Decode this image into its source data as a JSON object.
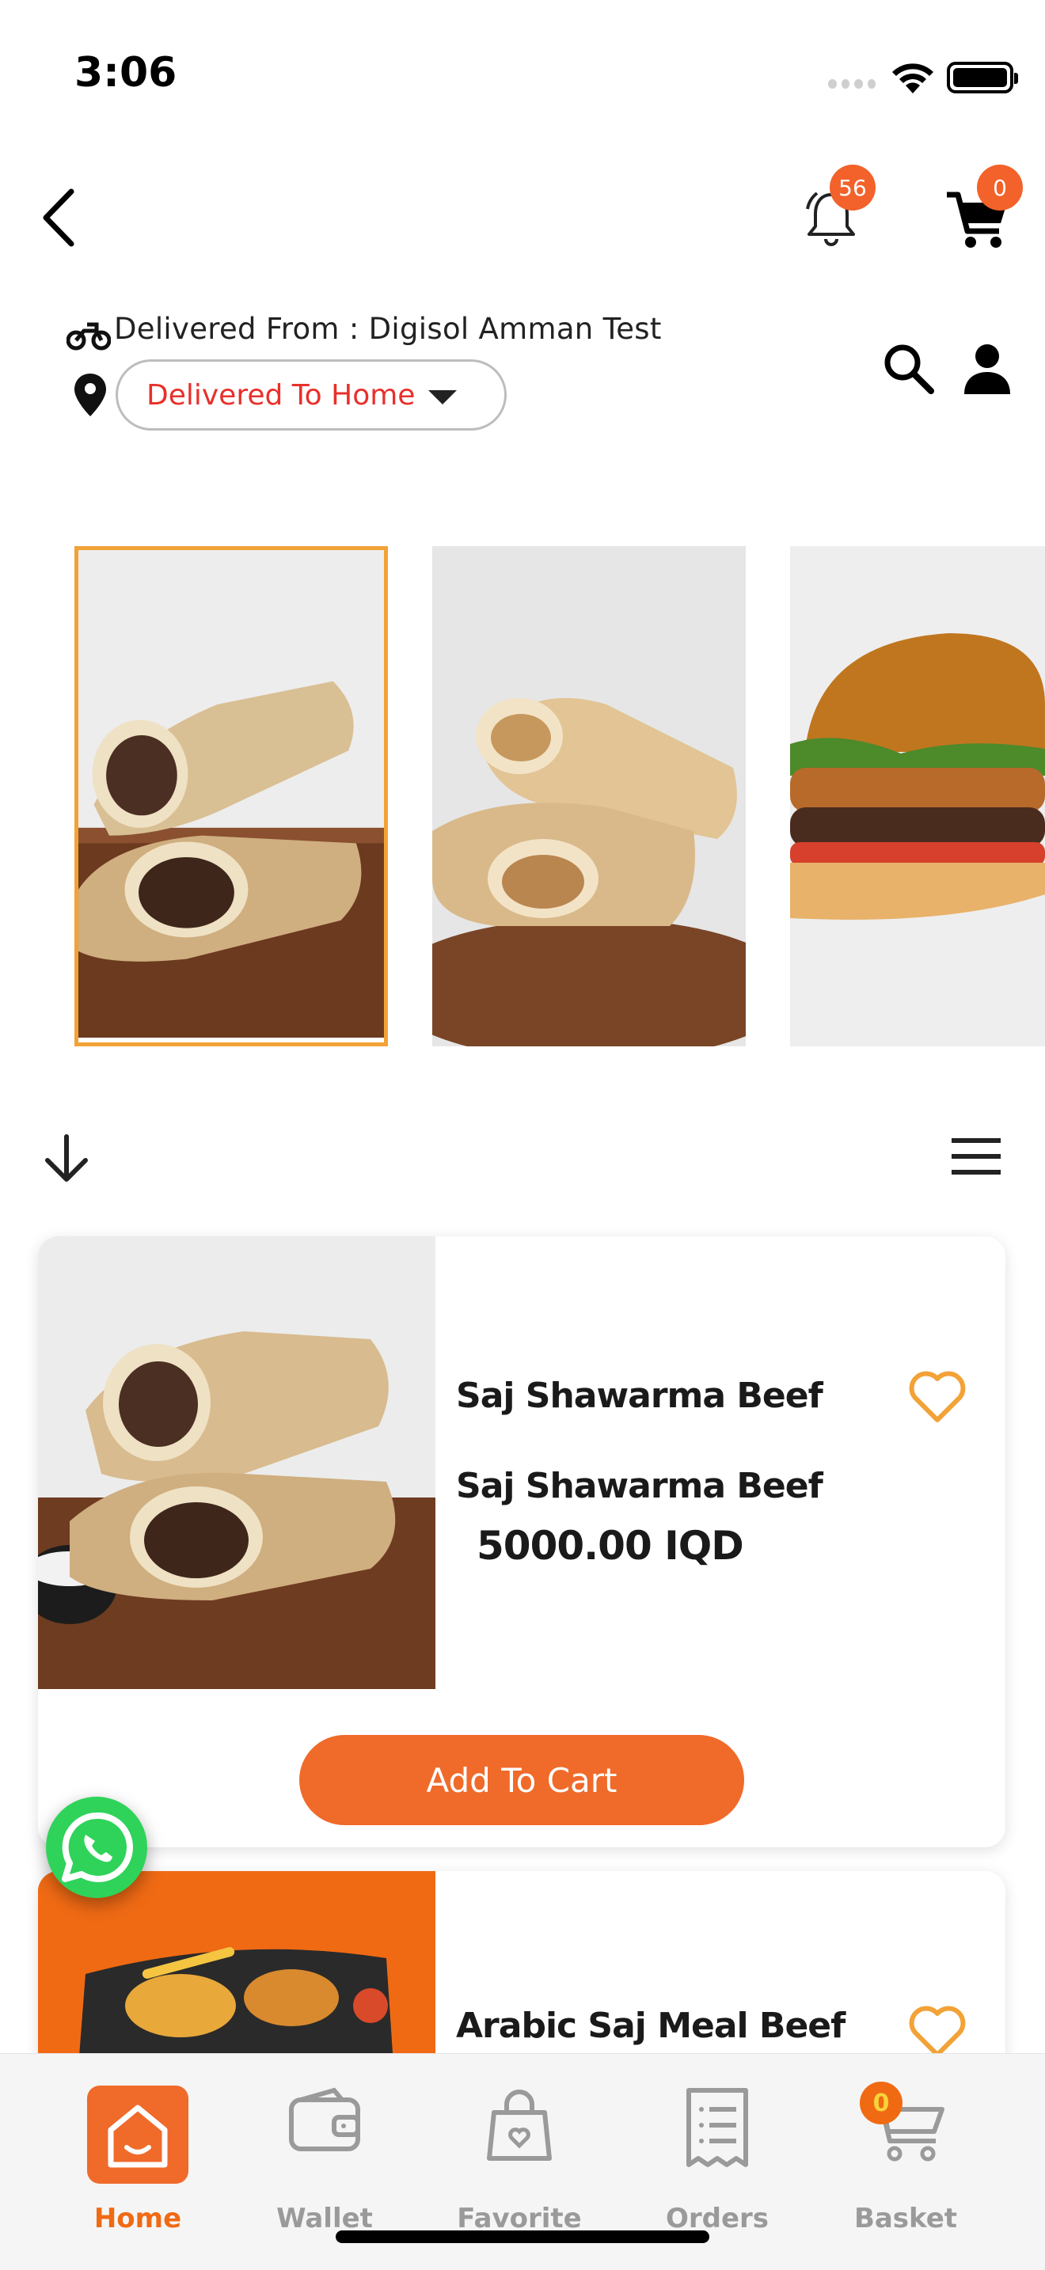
{
  "status_bar": {
    "time": "3:06"
  },
  "header": {
    "notification_count": "56",
    "cart_count": "0"
  },
  "delivery": {
    "from_text": "Delivered From : Digisol Amman Test",
    "to_selected": "Delivered To Home"
  },
  "categories": [
    {
      "icon": "shawarma-beef-image",
      "selected": true
    },
    {
      "icon": "shawarma-chicken-image",
      "selected": false
    },
    {
      "icon": "burger-image",
      "selected": false
    }
  ],
  "products": [
    {
      "name": "Saj Shawarma Beef",
      "description": "Saj Shawarma Beef",
      "price": "5000.00 IQD",
      "add_label": "Add To Cart"
    },
    {
      "name": "Arabic Saj Meal Beef"
    }
  ],
  "tabbar": {
    "items": [
      {
        "label": "Home",
        "icon": "home-icon",
        "active": true
      },
      {
        "label": "Wallet",
        "icon": "wallet-icon",
        "active": false
      },
      {
        "label": "Favorite",
        "icon": "favorite-bag-icon",
        "active": false
      },
      {
        "label": "Orders",
        "icon": "orders-icon",
        "active": false
      },
      {
        "label": "Basket",
        "icon": "basket-icon",
        "active": false
      }
    ],
    "basket_count": "0"
  },
  "colors": {
    "accent": "#f06a2a",
    "badge": "#f2622a",
    "selected_border": "#f2a236",
    "delivery_text": "#e8302b",
    "inactive_tab": "#9a9a9a"
  }
}
